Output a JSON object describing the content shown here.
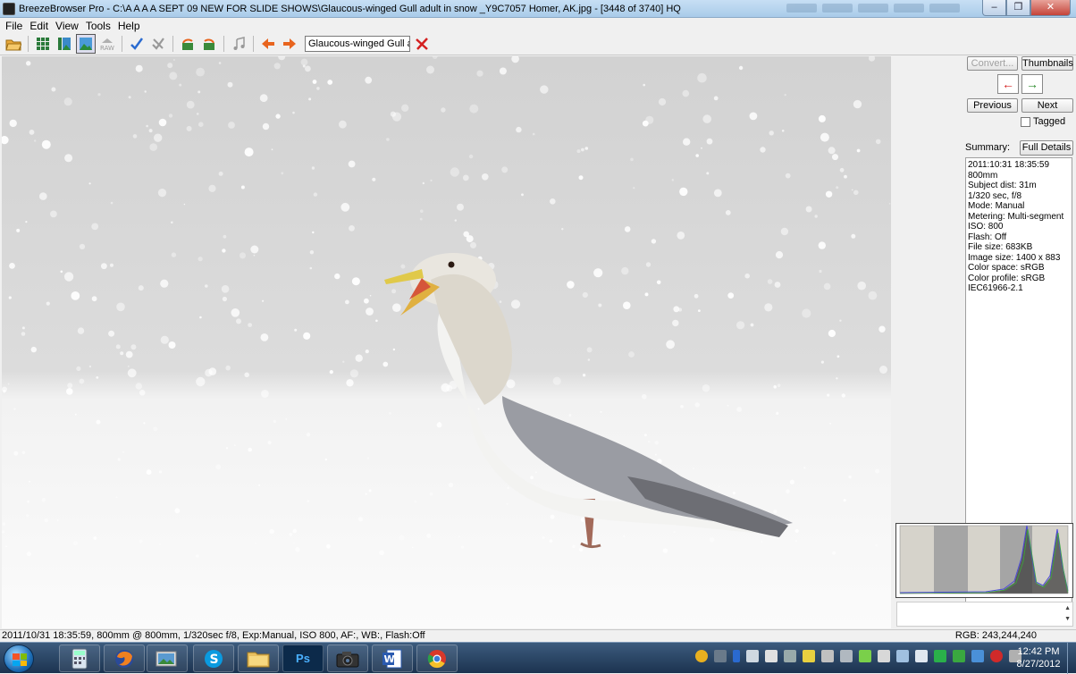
{
  "window": {
    "title": "BreezeBrowser Pro - C:\\A A A A SEPT 09 NEW FOR SLIDE SHOWS\\Glaucous-winged Gull adult in snow _Y9C7057  Homer, AK.jpg - [3448 of 3740] HQ",
    "min_label": "–",
    "max_label": "❐",
    "close_label": "✕"
  },
  "menu": [
    "File",
    "Edit",
    "View",
    "Tools",
    "Help"
  ],
  "toolbar": {
    "icons": [
      "open-folder-icon",
      "thumbnail-grid-icon",
      "thumbnail-preview-icon",
      "image-view-icon",
      "raw-icon",
      "tag-check-icon",
      "untag-icon",
      "rotate-left-icon",
      "rotate-right-icon",
      "music-icon",
      "previous-arrow-icon",
      "next-arrow-icon"
    ],
    "file_select_value": "Glaucous-winged Gull ad",
    "delete_icon": "delete-x-icon"
  },
  "side": {
    "convert_label": "Convert...",
    "thumbnails_label": "Thumbnails",
    "prev_icon_label": "←",
    "next_icon_label": "→",
    "previous_label": "Previous",
    "next_label": "Next",
    "tagged_label": "Tagged",
    "summary_label": "Summary:",
    "full_details_label": "Full Details",
    "summary_lines": [
      "2011:10:31 18:35:59",
      "800mm",
      "Subject dist: 31m",
      "1/320 sec, f/8",
      "Mode: Manual",
      "Metering: Multi-segment",
      "ISO: 800",
      "Flash: Off",
      "File size: 683KB",
      "Image size: 1400 x 883",
      "Color space: sRGB",
      "Color profile: sRGB",
      "IEC61966-2.1"
    ],
    "scroll_up": "▲",
    "scroll_down": "▼"
  },
  "status": {
    "exif": "2011/10/31 18:35:59, 800mm @ 800mm, 1/320sec f/8, Exp:Manual, ISO 800, AF:, WB:, Flash:Off",
    "rgb": "RGB: 243,244,240"
  },
  "taskbar": {
    "apps": [
      "calculator-icon",
      "firefox-icon",
      "photo-viewer-icon",
      "skype-icon",
      "explorer-folder-icon",
      "photoshop-icon",
      "camera-app-icon",
      "word-icon",
      "chrome-icon"
    ],
    "app_glyphs": [
      "",
      "",
      "",
      "S",
      "",
      "Ps",
      "",
      "W",
      ""
    ],
    "time": "12:42 PM",
    "date": "8/27/2012"
  },
  "colors": {
    "title_bar": "#b9d4ee",
    "taskbar": "#2a4566",
    "toolbar_arrow": "#e8641e",
    "delete_red": "#d42020",
    "check_blue": "#2a6bd0"
  }
}
